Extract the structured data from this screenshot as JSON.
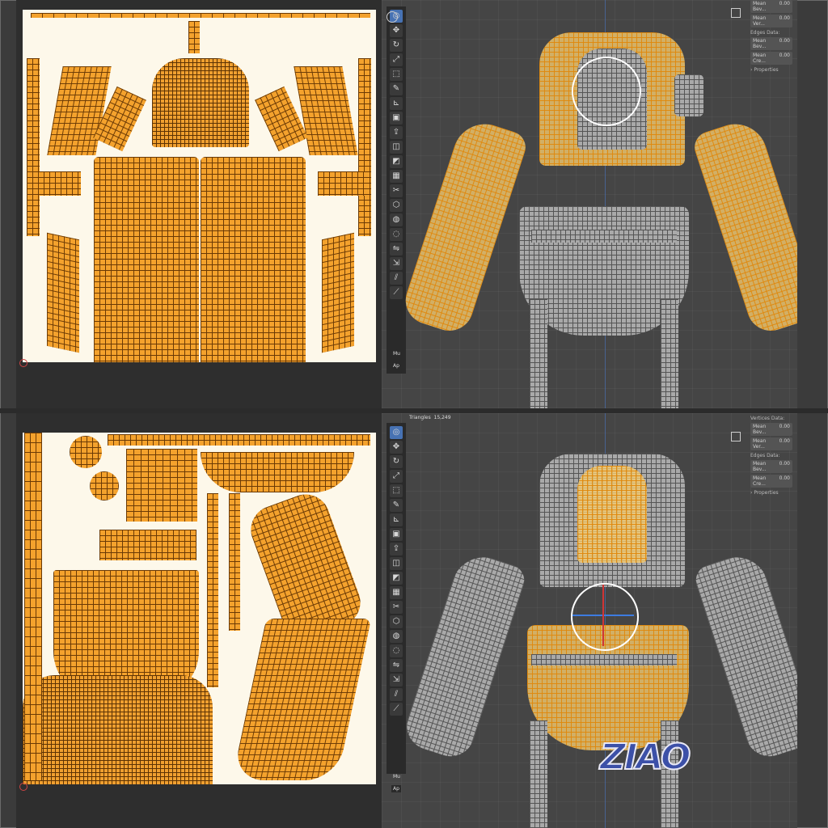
{
  "top_panel": {
    "sidebar": {
      "rows": [
        {
          "label": "Mean Bev...",
          "value": "0.00"
        },
        {
          "label": "Mean Ver...",
          "value": "0.00"
        }
      ],
      "edges_header": "Edges Data:",
      "edge_rows": [
        {
          "label": "Mean Bev...",
          "value": "0.00"
        },
        {
          "label": "Mean Cre...",
          "value": "0.00"
        }
      ],
      "properties": "Properties"
    },
    "toolbar_footer": "Mu",
    "toolbar_footer2": "Ap"
  },
  "bottom_panel": {
    "stats": {
      "label": "Triangles",
      "value": "15,249"
    },
    "sidebar": {
      "vertices_header": "Vertices Data:",
      "rows": [
        {
          "label": "Mean Bev...",
          "value": "0.00"
        },
        {
          "label": "Mean Ver...",
          "value": "0.00"
        }
      ],
      "edges_header": "Edges Data:",
      "edge_rows": [
        {
          "label": "Mean Bev...",
          "value": "0.00"
        },
        {
          "label": "Mean Cre...",
          "value": "0.00"
        }
      ],
      "properties": "Properties"
    },
    "toolbar_footer": "Mu",
    "toolbar_footer2": "Ap"
  },
  "watermark": "ZIAO",
  "colors": {
    "uv_orange": "#f4a22d",
    "uv_bg": "#fdf8ea",
    "viewport": "#454545",
    "mesh_gray": "#a9a9a9",
    "active_tool": "#4772b3"
  },
  "tools": [
    "cursor-icon",
    "move-icon",
    "rotate-icon",
    "scale-icon",
    "transform-icon",
    "annotate-icon",
    "measure-icon",
    "add-cube-icon",
    "extrude-icon",
    "inset-icon",
    "bevel-icon",
    "loopcut-icon",
    "knife-icon",
    "polybuild-icon",
    "spin-icon",
    "smooth-icon",
    "edge-slide-icon",
    "shrink-icon",
    "shear-icon",
    "rip-icon"
  ]
}
